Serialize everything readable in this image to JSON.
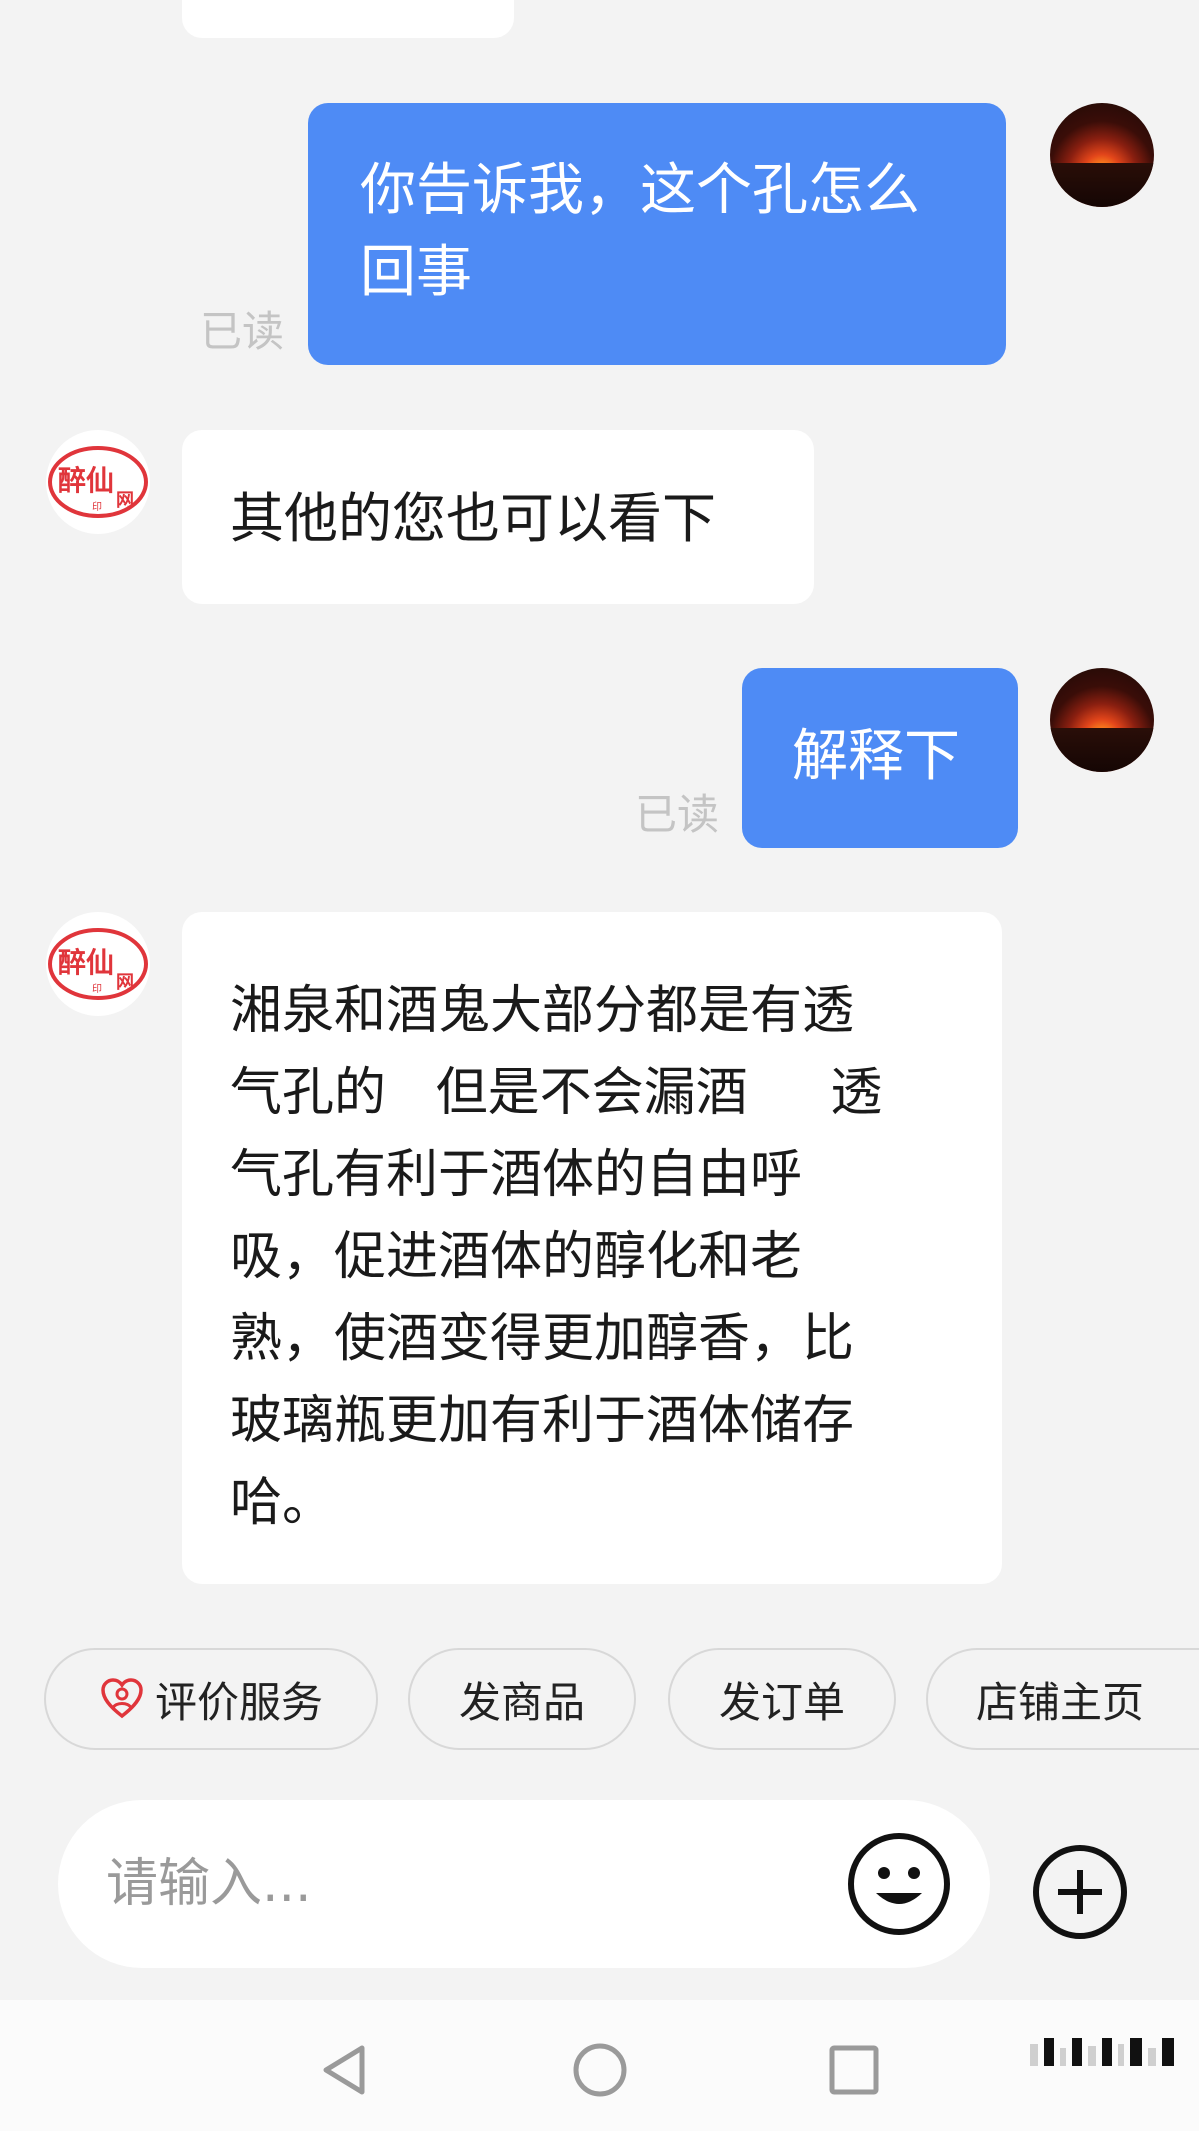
{
  "messages": [
    {
      "side": "out",
      "text": "你告诉我，这个孔怎么\n回事",
      "read_label": "已读"
    },
    {
      "side": "in",
      "text": "其他的您也可以看下"
    },
    {
      "side": "out",
      "text": "解释下",
      "read_label": "已读"
    },
    {
      "side": "in",
      "text": "湘泉和酒鬼大部分都是有透\n气孔的   但是不会漏酒     透\n气孔有利于酒体的自由呼\n吸，促进酒体的醇化和老\n熟，使酒变得更加醇香，比\n玻璃瓶更加有利于酒体储存\n哈。"
    }
  ],
  "shop_avatar": {
    "line1": "醉仙",
    "line2": "网",
    "seal": "印"
  },
  "quick_actions": [
    {
      "label": "评价服务",
      "icon": "heart-person-icon"
    },
    {
      "label": "发商品"
    },
    {
      "label": "发订单"
    },
    {
      "label": "店铺主页"
    }
  ],
  "composer": {
    "placeholder": "请输入...",
    "emoji_icon": "smiley-icon",
    "add_icon": "plus-circle-icon"
  },
  "navbar": {
    "icons": [
      "back-triangle-icon",
      "home-circle-icon",
      "recents-square-icon"
    ]
  },
  "colors": {
    "outgoing": "#4e8bf5",
    "incoming": "#ffffff",
    "background": "#f3f3f3",
    "read": "#c4c4c4",
    "accent_red": "#e0353b"
  }
}
